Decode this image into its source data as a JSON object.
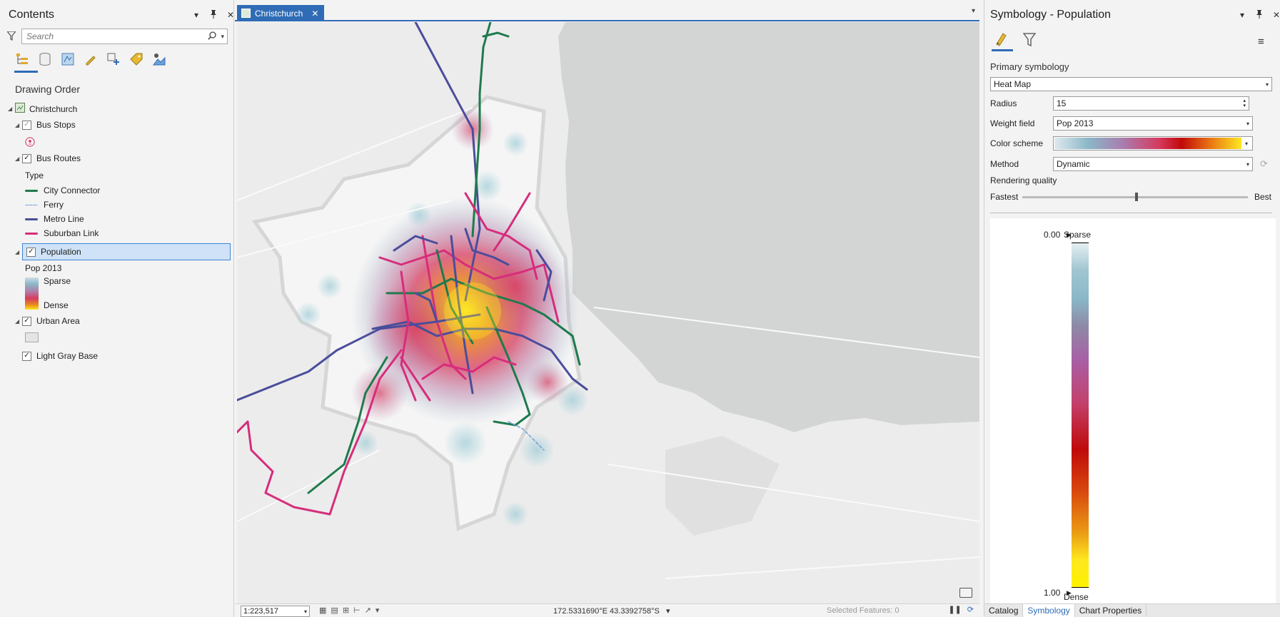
{
  "contents": {
    "title": "Contents",
    "search_placeholder": "Search",
    "drawing_order_label": "Drawing Order",
    "map_name": "Christchurch",
    "bus_stops": "Bus Stops",
    "bus_routes": "Bus Routes",
    "type_label": "Type",
    "route_types": [
      {
        "label": "City Connector",
        "color": "#1f7a4d"
      },
      {
        "label": "Ferry",
        "color": "#6f9fd8"
      },
      {
        "label": "Metro Line",
        "color": "#4a4d9c"
      },
      {
        "label": "Suburban Link",
        "color": "#d62d7b"
      }
    ],
    "population": "Population",
    "pop_field": "Pop 2013",
    "sparse": "Sparse",
    "dense": "Dense",
    "urban_area": "Urban Area",
    "light_gray_base": "Light Gray Base"
  },
  "map": {
    "tab_label": "Christchurch",
    "scale": "1:223,517",
    "coordinates": "172.5331690°E 43.3392758°S",
    "selected_features": "Selected Features: 0"
  },
  "symbology": {
    "title": "Symbology - Population",
    "primary_label": "Primary symbology",
    "renderer": "Heat Map",
    "radius_label": "Radius",
    "radius_value": "15",
    "weight_label": "Weight field",
    "weight_value": "Pop 2013",
    "color_scheme_label": "Color scheme",
    "method_label": "Method",
    "method_value": "Dynamic",
    "rendering_quality_label": "Rendering quality",
    "fastest": "Fastest",
    "best": "Best",
    "rendering_quality_level": 0.5,
    "ramp_top_value": "0.00",
    "ramp_bottom_value": "1.00",
    "ramp_top_label": "Sparse",
    "ramp_bottom_label": "Dense",
    "bottom_tabs": [
      "Catalog",
      "Symbology",
      "Chart Properties"
    ]
  },
  "colors": {
    "accent": "#2f6cb5",
    "city_connector": "#1f7a4d",
    "metro": "#4a4d9c",
    "suburban": "#d62d7b",
    "ferry": "#6f9fd8"
  }
}
